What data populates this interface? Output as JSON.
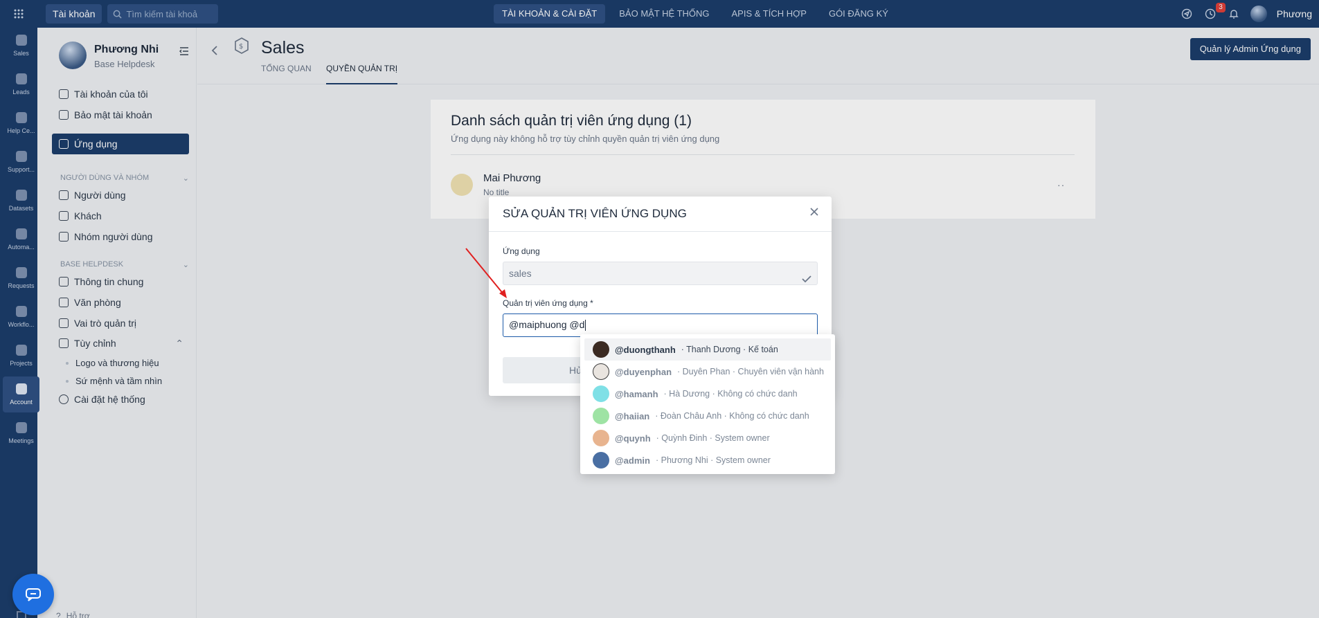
{
  "topbar": {
    "account_btn": "Tài khoản",
    "search_placeholder": "Tìm kiếm tài khoả",
    "nav": [
      "TÀI KHOẢN & CÀI ĐẶT",
      "BẢO MẬT HỆ THỐNG",
      "APIS & TÍCH HỢP",
      "GÓI ĐĂNG KÝ"
    ],
    "notification_count": "3",
    "user": "Phương"
  },
  "rail": [
    "Sales",
    "Leads",
    "Help Ce...",
    "Support...",
    "Datasets",
    "Automa...",
    "Requests",
    "Workflo...",
    "Projects",
    "Account",
    "Meetings"
  ],
  "sidebar": {
    "name": "Phương Nhi",
    "sub": "Base Helpdesk",
    "items": [
      "Tài khoản của tôi",
      "Bảo mật tài khoản",
      "Ứng dụng"
    ],
    "section1": "NGƯỜI DÙNG VÀ NHÓM",
    "section1_items": [
      "Người dùng",
      "Khách",
      "Nhóm người dùng"
    ],
    "section2": "BASE HELPDESK",
    "section2_items": [
      "Thông tin chung",
      "Văn phòng",
      "Vai trò quản trị",
      "Tùy chỉnh"
    ],
    "sub_items": [
      "Logo và thương hiệu",
      "Sứ mệnh và tầm nhìn"
    ],
    "system": "Cài đặt hệ thống",
    "footer": "Hỗ trợ"
  },
  "header": {
    "title": "Sales",
    "tabs": [
      "TỔNG QUAN",
      "QUYỀN QUẢN TRỊ"
    ],
    "manage_btn": "Quản lý Admin Ứng dụng"
  },
  "card": {
    "title": "Danh sách quản trị viên ứng dụng (1)",
    "sub": "Ứng dụng này không hỗ trợ tùy chỉnh quyền quản trị viên ứng dụng",
    "member_name": "Mai Phương",
    "member_title": "No title"
  },
  "modal": {
    "title": "SỬA QUẢN TRỊ VIÊN ỨNG DỤNG",
    "app_label": "Ứng dụng",
    "app_value": "sales",
    "admin_label": "Quản trị viên ứng dụng *",
    "admin_value": "@maiphuong @d",
    "cancel_btn": "Hủ"
  },
  "mentions": [
    {
      "handle": "@duongthanh",
      "rest": "· Thanh Dương · Kế toán",
      "color": "#3b2a22"
    },
    {
      "handle": "@duyenphan",
      "rest": "· Duyên Phan · Chuyên viên vận hành",
      "color": "#e9e4df"
    },
    {
      "handle": "@hamanh",
      "rest": "· Hà Dương · Không có chức danh",
      "color": "#7fe0e6"
    },
    {
      "handle": "@haiian",
      "rest": "· Đoàn Châu Anh · Không có chức danh",
      "color": "#9ee3a4"
    },
    {
      "handle": "@quynh",
      "rest": "· Quỳnh Đinh · System owner",
      "color": "#e8b48f"
    },
    {
      "handle": "@admin",
      "rest": "· Phương Nhi · System owner",
      "color": "#4a6fa3"
    }
  ]
}
